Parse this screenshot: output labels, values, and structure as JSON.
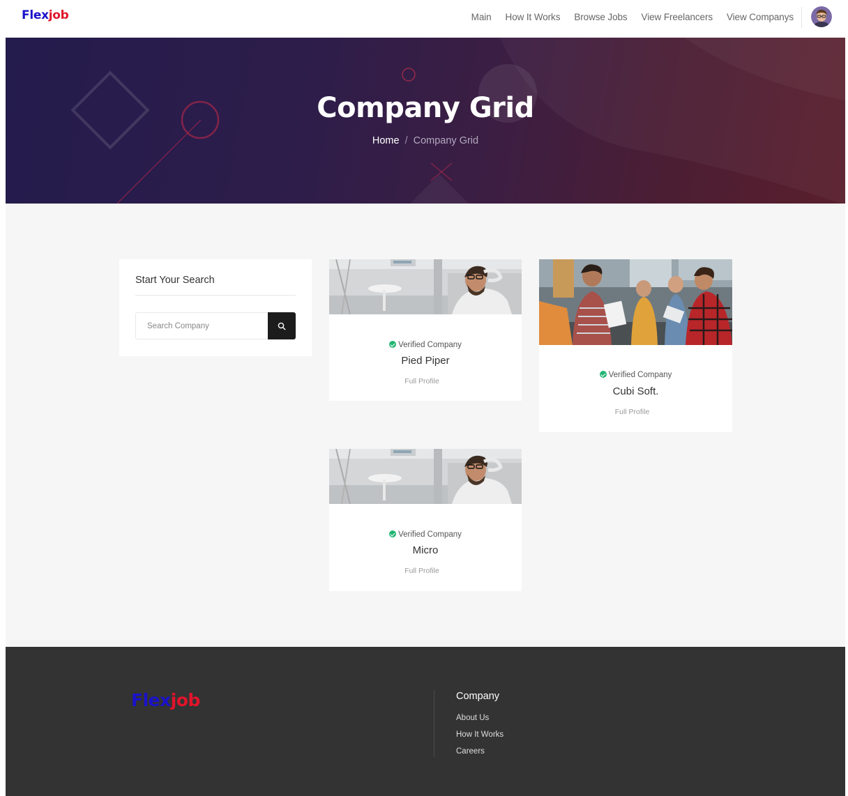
{
  "brand": {
    "part1": "Flex",
    "part2": "job"
  },
  "nav": {
    "items": [
      "Main",
      "How It Works",
      "Browse Jobs",
      "View Freelancers",
      "View Companys"
    ]
  },
  "hero": {
    "title": "Company Grid",
    "breadcrumb": {
      "home": "Home",
      "separator": "/",
      "current": "Company Grid"
    }
  },
  "search": {
    "title": "Start Your Search",
    "placeholder": "Search Company",
    "value": ""
  },
  "companies": [
    {
      "badge": "Verified Company",
      "name": "Pied Piper",
      "link": "Full Profile",
      "image": "man-relaxing-office-photo"
    },
    {
      "badge": "Verified Company",
      "name": "Cubi Soft.",
      "link": "Full Profile",
      "image": "team-meeting-photo"
    },
    {
      "badge": "Verified Company",
      "name": "Micro",
      "link": "Full Profile",
      "image": "man-relaxing-office-photo"
    }
  ],
  "footer": {
    "brand": {
      "part1": "Flex",
      "part2": "job"
    },
    "heading": "Company",
    "links": [
      "About Us",
      "How It Works",
      "Careers"
    ]
  },
  "colors": {
    "brand_blue": "#1a12c9",
    "brand_red": "#e0142b",
    "verified_green": "#22b573",
    "footer_bg": "#333333"
  },
  "icons": {
    "search": "search-icon",
    "verified": "check-circle-icon"
  }
}
